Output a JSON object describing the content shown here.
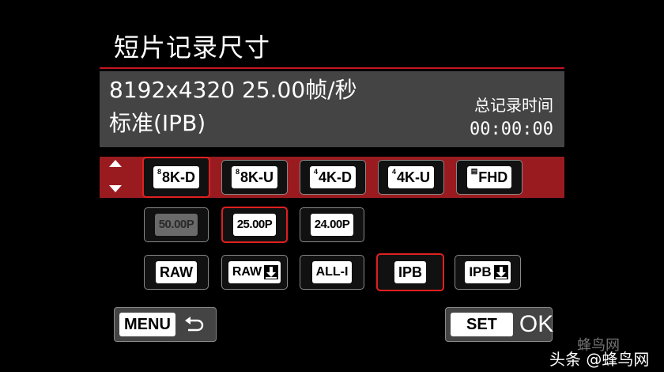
{
  "title": "短片记录尺寸",
  "info": {
    "line1": "8192x4320 25.00帧/秒",
    "line2": "标准(IPB)",
    "rec_label": "总记录时间",
    "rec_time": "00:00:00"
  },
  "sizes": [
    {
      "mini": "8",
      "label": "8K-D"
    },
    {
      "mini": "8",
      "label": "8K-U"
    },
    {
      "mini": "4",
      "label": "4K-D"
    },
    {
      "mini": "4",
      "label": "4K-U"
    },
    {
      "mini": "",
      "label": "FHD"
    }
  ],
  "frame_rates": [
    "50.00P",
    "25.00P",
    "24.00P"
  ],
  "compression": [
    "RAW",
    "RAW",
    "ALL-I",
    "IPB",
    "IPB"
  ],
  "buttons": {
    "menu": "MENU",
    "set": "SET",
    "ok": "OK"
  },
  "watermark": {
    "top": "蜂鸟网",
    "bottom": "头条 @蜂鸟网"
  },
  "colors": {
    "accent_red": "#c2151f",
    "band_red": "#9a1b1f",
    "panel_gray": "#444444"
  }
}
